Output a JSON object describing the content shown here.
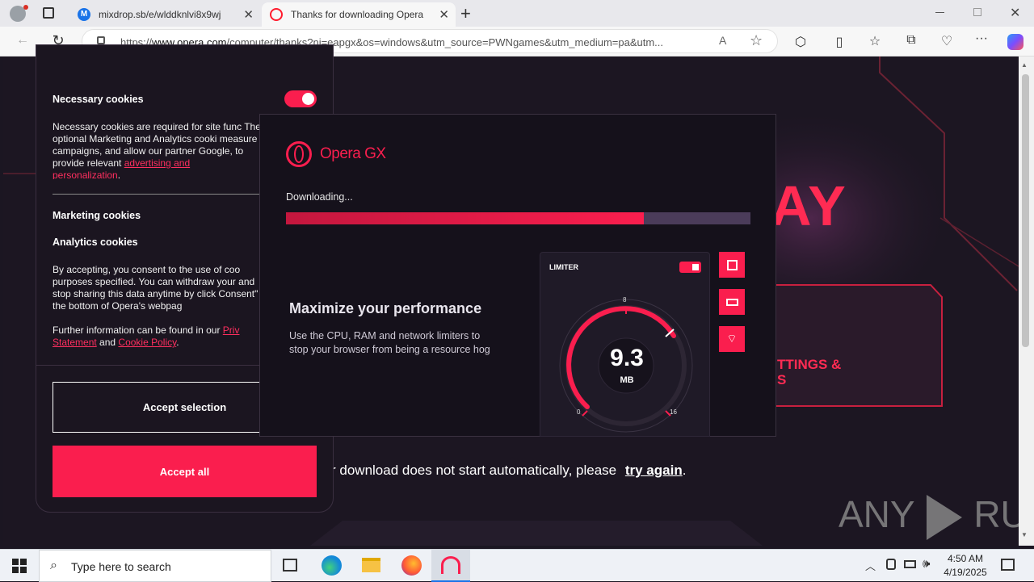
{
  "tabs": [
    {
      "title": "mixdrop.sb/e/wlddknlvi8x9wj",
      "favicon_color": "#1a73e8"
    },
    {
      "title": "Thanks for downloading Opera",
      "favicon_color": "#ff1b2d"
    }
  ],
  "address": {
    "url_prefix": "https://",
    "url_domain": "www.opera.com",
    "url_rest": "/computer/thanks?ni=eapgx&os=windows&utm_source=PWNgames&utm_medium=pa&utm..."
  },
  "cookie": {
    "necessary_title": "Necessary cookies",
    "necessary_text": "Necessary cookies are required for site func The optional Marketing and Analytics cooki measure campaigns, and allow our partner Google, to provide relevant",
    "necessary_link1": "advertising and",
    "necessary_link2": "personalization",
    "marketing_title": "Marketing cookies",
    "analytics_title": "Analytics cookies",
    "consent_text": "By accepting, you consent to the use of coo purposes specified. You can withdraw your and stop sharing this data anytime by click Consent\" at the bottom of Opera's webpag",
    "further_text": "Further information can be found in our",
    "privacy_link": "Priv",
    "statement_link": "Statement",
    "and_text": "and",
    "cookie_policy_link": "Cookie Policy",
    "accept_selection": "Accept selection",
    "accept_all": "Accept all"
  },
  "dialog": {
    "brand": "Opera GX",
    "downloading": "Downloading...",
    "progress": 0.77,
    "headline": "Maximize your performance",
    "subtext_1": "Use the CPU, RAM and network limiters to",
    "subtext_2": "stop your browser from being a resource hog",
    "limiter_label": "LIMITER",
    "gauge_value": "9.3",
    "gauge_unit": "MB",
    "gauge_min": "0",
    "gauge_mid": "8",
    "gauge_max": "16"
  },
  "background": {
    "big_text": "AY",
    "settings_1": "TTINGS &",
    "settings_2": "S",
    "retry_text": "r download does not start automatically, please",
    "retry_link": "try again",
    "period": "."
  },
  "watermark": {
    "left": "ANY",
    "right": "RUN"
  },
  "taskbar": {
    "search_placeholder": "Type here to search",
    "time": "4:50 AM",
    "date": "4/19/2025"
  },
  "colors": {
    "accent": "#fa1e4e",
    "page_bg": "#1c1622"
  }
}
